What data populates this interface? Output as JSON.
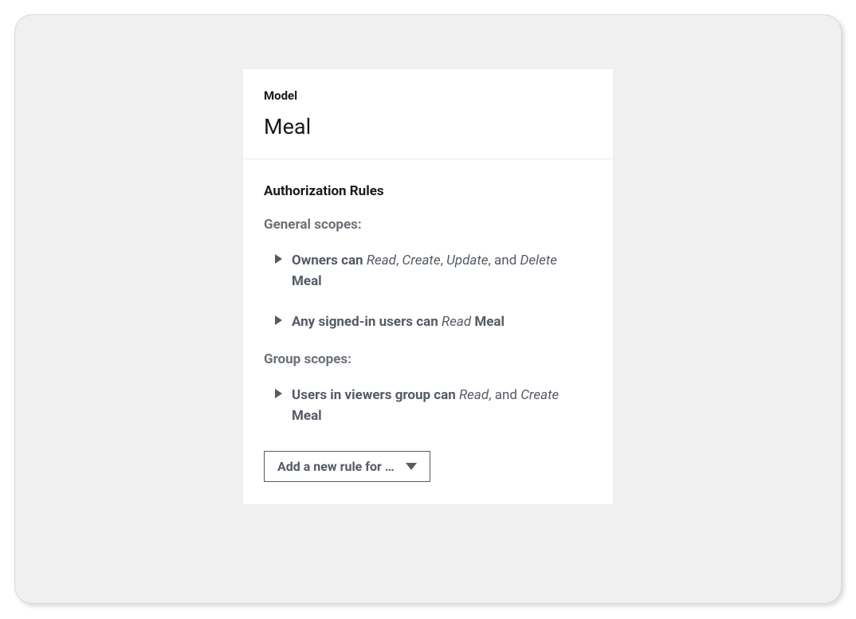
{
  "header": {
    "label": "Model",
    "model_name": "Meal"
  },
  "authorization": {
    "title": "Authorization Rules",
    "general_scopes_label": "General scopes:",
    "group_scopes_label": "Group scopes:",
    "rules": {
      "owners": {
        "subject": "Owners can ",
        "v1": "Read",
        "sep1": ", ",
        "v2": "Create",
        "sep2": ", ",
        "v3": "Update",
        "sep3": ", and ",
        "v4": "Delete",
        "tail": " Meal"
      },
      "signed_in": {
        "subject": "Any signed-in users can ",
        "v1": "Read",
        "tail": " Meal"
      },
      "viewers": {
        "subject": "Users in viewers group can ",
        "v1": "Read",
        "sep1": ", and ",
        "v2": "Create",
        "tail": " Meal"
      }
    },
    "add_rule_label": "Add a new rule for …"
  }
}
